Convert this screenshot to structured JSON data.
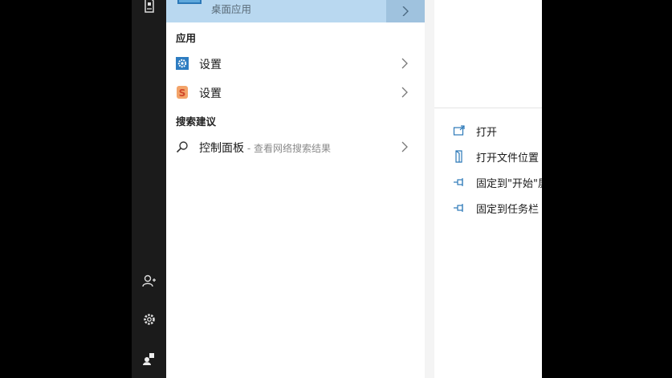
{
  "top_hit": {
    "subtitle": "桌面应用"
  },
  "sections": {
    "apps": "应用",
    "suggestions": "搜索建议"
  },
  "apps": [
    {
      "label": "设置",
      "icon": "settings-gear-icon"
    },
    {
      "label": "设置",
      "icon": "sogou-settings-icon"
    }
  ],
  "suggestion": {
    "label": "控制面板",
    "suffix": " - 查看网络搜索结果",
    "icon": "search-icon"
  },
  "actions": [
    {
      "label": "打开",
      "icon": "open-icon"
    },
    {
      "label": "打开文件位置",
      "icon": "file-location-icon"
    },
    {
      "label": "固定到\"开始\"屏幕",
      "icon": "pin-icon"
    },
    {
      "label": "固定到任务栏",
      "icon": "pin-icon"
    }
  ],
  "rail": [
    "document-icon",
    "add-user-icon",
    "settings-icon",
    "user-account-icon"
  ],
  "colors": {
    "highlight": "#b9d8f0",
    "accent": "#2b78b8",
    "rail": "#1b1b1b"
  }
}
